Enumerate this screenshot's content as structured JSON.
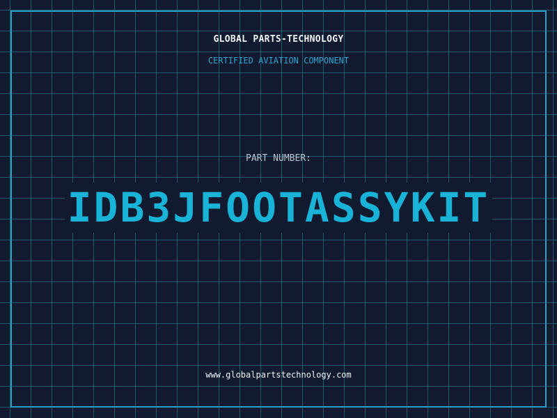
{
  "header": {
    "company_name": "GLOBAL PARTS-TECHNOLOGY",
    "subtitle": "CERTIFIED AVIATION COMPONENT"
  },
  "part": {
    "label": "PART NUMBER:",
    "number": "IDB3JFOOTASSYKIT"
  },
  "footer": {
    "website": "www.globalpartstechnology.com"
  },
  "colors": {
    "background": "#111a2e",
    "grid": "#288ca0",
    "accent": "#18b3d6",
    "frame": "#2a9fc4",
    "text_light": "#f1f5f8",
    "text_muted": "#b8c1cc"
  }
}
